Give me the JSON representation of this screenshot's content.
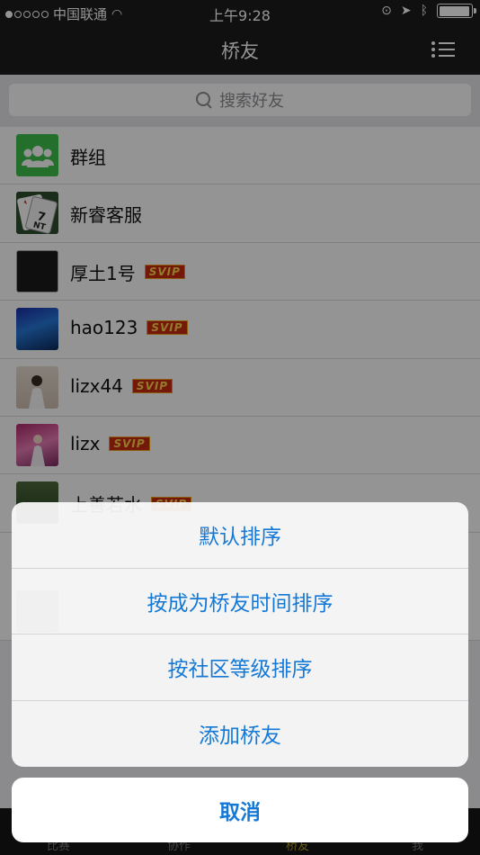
{
  "status_bar": {
    "carrier": "中国联通",
    "time": "上午9:28",
    "signal_bars_filled": 1,
    "signal_bars_total": 5,
    "battery_level": 0.95
  },
  "nav": {
    "title": "桥友",
    "menu_icon": "list-menu-icon"
  },
  "search": {
    "placeholder": "搜索好友",
    "icon": "search-icon"
  },
  "friends": [
    {
      "name": "群组",
      "badge": "",
      "avatar": "group-icon"
    },
    {
      "name": "新睿客服",
      "badge": "",
      "avatar": "playing-card-avatar"
    },
    {
      "name": "厚土1号",
      "badge": "SVIP",
      "avatar": "dark-avatar"
    },
    {
      "name": "hao123",
      "badge": "SVIP",
      "avatar": "blue-photo-avatar"
    },
    {
      "name": "lizx44",
      "badge": "SVIP",
      "avatar": "girl-photo-avatar"
    },
    {
      "name": "lizx",
      "badge": "SVIP",
      "avatar": "pink-photo-avatar"
    },
    {
      "name": "上善若水",
      "badge": "SVIP",
      "avatar": "landscape-avatar"
    }
  ],
  "action_sheet": {
    "options": [
      "默认排序",
      "按成为桥友时间排序",
      "按社区等级排序",
      "添加桥友"
    ],
    "cancel": "取消"
  },
  "tab_bar": {
    "tabs": [
      "比赛",
      "协作",
      "桥友",
      "我"
    ]
  },
  "colors": {
    "nav_background": "#1d1d1d",
    "action_text": "#1479d6",
    "svip_badge": "#c82a12"
  }
}
